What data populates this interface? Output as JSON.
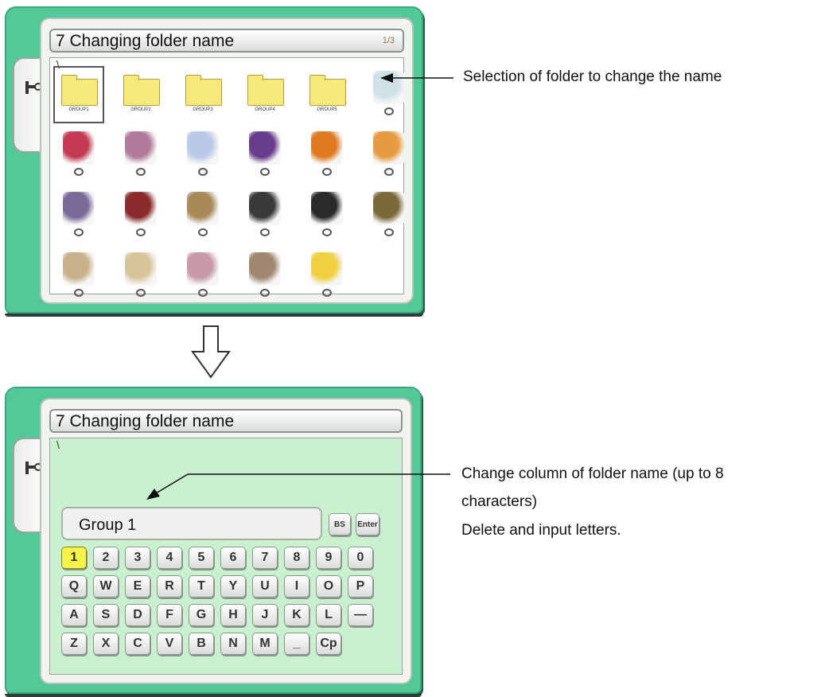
{
  "screen1": {
    "title": "7 Changing folder name",
    "page": "1/3",
    "path": "\\",
    "folders": [
      {
        "name": "GROUP1"
      },
      {
        "name": "GROUP2"
      },
      {
        "name": "GROUP3"
      },
      {
        "name": "GROUP4"
      },
      {
        "name": "GROUP5"
      }
    ],
    "designs": [
      {
        "icon": "sewing-machine-design-icon",
        "color": "#cfe0e6"
      },
      {
        "icon": "roses-design-icon",
        "color": "#c43a52"
      },
      {
        "icon": "flower-basket-design-icon",
        "color": "#b27a9a"
      },
      {
        "icon": "music-staff-design-icon",
        "color": "#b9c9e8"
      },
      {
        "icon": "grapes-wreath-design-icon",
        "color": "#6a3d8c"
      },
      {
        "icon": "pumpkin-design-icon",
        "color": "#e07a20"
      },
      {
        "icon": "orange-flowers-design-icon",
        "color": "#e89a40"
      },
      {
        "icon": "bear-design-icon",
        "color": "#7a6a9a"
      },
      {
        "icon": "ship-badge-design-icon",
        "color": "#8a2a2a"
      },
      {
        "icon": "helmet-design-icon",
        "color": "#a88a5a"
      },
      {
        "icon": "panther-design-icon",
        "color": "#3a3a3a"
      },
      {
        "icon": "t-logo-design-icon",
        "color": "#2a2a2a"
      },
      {
        "icon": "s-logo-design-icon",
        "color": "#7a6a3a"
      },
      {
        "icon": "pattern-strip-design-icon",
        "color": "#c8b08a"
      },
      {
        "icon": "lace-design-icon",
        "color": "#d8c49a"
      },
      {
        "icon": "tulip-design-icon",
        "color": "#c89aa8"
      },
      {
        "icon": "cat-frame-design-icon",
        "color": "#a08870"
      },
      {
        "icon": "daisy-design-icon",
        "color": "#f0d040"
      }
    ]
  },
  "screen2": {
    "title": "7 Changing folder name",
    "path": "\\",
    "input_value": "Group 1",
    "bs_label": "BS",
    "enter_label": "Enter",
    "rows": [
      [
        "1",
        "2",
        "3",
        "4",
        "5",
        "6",
        "7",
        "8",
        "9",
        "0"
      ],
      [
        "Q",
        "W",
        "E",
        "R",
        "T",
        "Y",
        "U",
        "I",
        "O",
        "P"
      ],
      [
        "A",
        "S",
        "D",
        "F",
        "G",
        "H",
        "J",
        "K",
        "L",
        "—"
      ],
      [
        "Z",
        "X",
        "C",
        "V",
        "B",
        "N",
        "M",
        "_",
        "Cp"
      ]
    ]
  },
  "callouts": {
    "select_folder": "Selection of folder to change the name",
    "change_column_line1": "Change column of folder name (up to 8",
    "change_column_line2": "characters)",
    "delete_input": "Delete and input letters."
  }
}
